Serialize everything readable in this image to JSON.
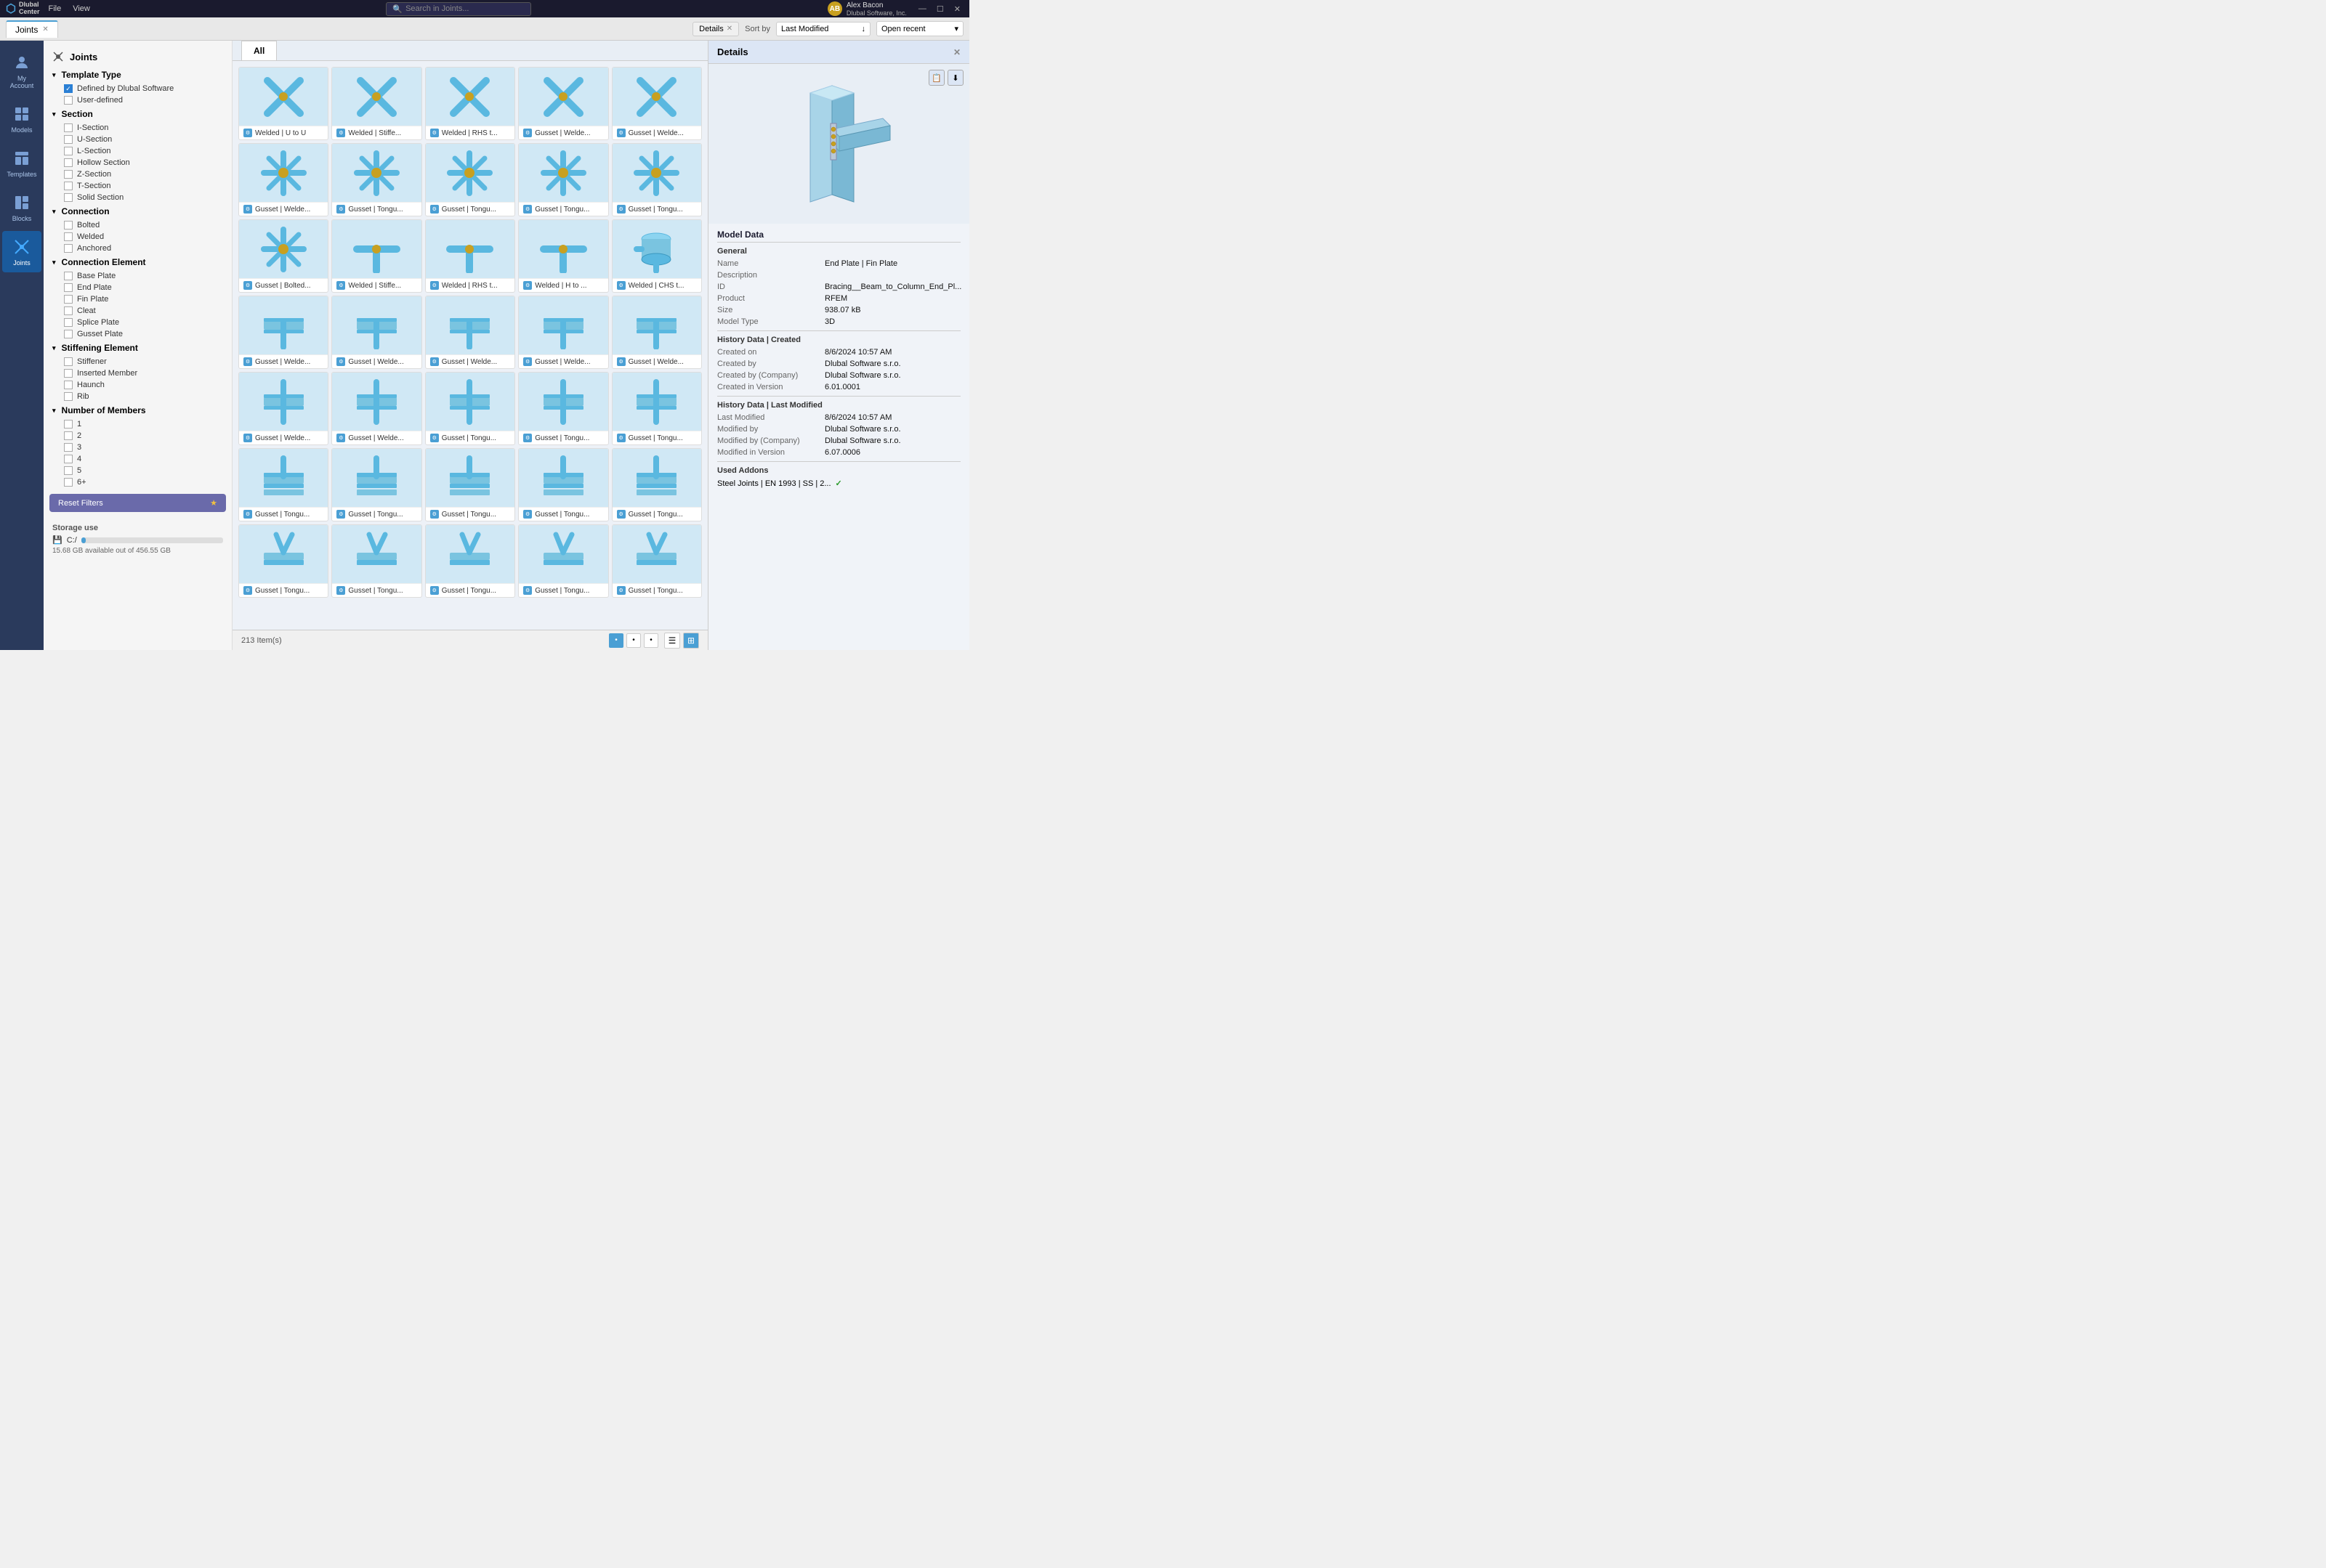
{
  "topbar": {
    "logo": "Dlubal Center",
    "menu": [
      "File",
      "View"
    ],
    "search_placeholder": "Search in Joints...",
    "user_name": "Alex Bacon",
    "user_company": "Dlubal Software, Inc.",
    "user_initials": "AB",
    "controls": [
      "—",
      "☐",
      "✕"
    ]
  },
  "tab": {
    "label": "Joints",
    "active": true
  },
  "toolbar": {
    "details_label": "Details",
    "sort_label": "Sort by",
    "sort_value": "Last Modified",
    "open_label": "Open recent",
    "sort_arrow": "↓"
  },
  "sidebar_icons": [
    {
      "id": "my-account",
      "label": "My Account",
      "icon": "person"
    },
    {
      "id": "models",
      "label": "Models",
      "icon": "cube"
    },
    {
      "id": "templates",
      "label": "Templates",
      "icon": "template"
    },
    {
      "id": "blocks",
      "label": "Blocks",
      "icon": "blocks"
    },
    {
      "id": "joints",
      "label": "Joints",
      "icon": "joints",
      "active": true
    }
  ],
  "filter_panel": {
    "title": "Joints",
    "sections": [
      {
        "id": "template-type",
        "label": "Template Type",
        "expanded": true,
        "items": [
          {
            "label": "Defined by Dlubal Software",
            "checked": true
          },
          {
            "label": "User-defined",
            "checked": false
          }
        ]
      },
      {
        "id": "section",
        "label": "Section",
        "expanded": true,
        "items": [
          {
            "label": "I-Section",
            "checked": false
          },
          {
            "label": "U-Section",
            "checked": false
          },
          {
            "label": "L-Section",
            "checked": false
          },
          {
            "label": "Hollow Section",
            "checked": false
          },
          {
            "label": "Z-Section",
            "checked": false
          },
          {
            "label": "T-Section",
            "checked": false
          },
          {
            "label": "Solid Section",
            "checked": false
          }
        ]
      },
      {
        "id": "connection",
        "label": "Connection",
        "expanded": true,
        "items": [
          {
            "label": "Bolted",
            "checked": false
          },
          {
            "label": "Welded",
            "checked": false
          },
          {
            "label": "Anchored",
            "checked": false
          }
        ]
      },
      {
        "id": "connection-element",
        "label": "Connection Element",
        "expanded": true,
        "items": [
          {
            "label": "Base Plate",
            "checked": false
          },
          {
            "label": "End Plate",
            "checked": false
          },
          {
            "label": "Fin Plate",
            "checked": false
          },
          {
            "label": "Cleat",
            "checked": false
          },
          {
            "label": "Splice Plate",
            "checked": false
          },
          {
            "label": "Gusset Plate",
            "checked": false
          }
        ]
      },
      {
        "id": "stiffening-element",
        "label": "Stiffening Element",
        "expanded": true,
        "items": [
          {
            "label": "Stiffener",
            "checked": false
          },
          {
            "label": "Inserted Member",
            "checked": false
          },
          {
            "label": "Haunch",
            "checked": false
          },
          {
            "label": "Rib",
            "checked": false
          }
        ]
      },
      {
        "id": "number-of-members",
        "label": "Number of Members",
        "expanded": true,
        "items": [
          {
            "label": "1",
            "checked": false
          },
          {
            "label": "2",
            "checked": false
          },
          {
            "label": "3",
            "checked": false
          },
          {
            "label": "4",
            "checked": false
          },
          {
            "label": "5",
            "checked": false
          },
          {
            "label": "6+",
            "checked": false
          }
        ]
      }
    ],
    "reset_label": "Reset Filters",
    "star_icon": "★",
    "storage_label": "Storage use",
    "storage_drive": "C:/",
    "storage_used_gb": "15.68",
    "storage_total_gb": "456.55",
    "storage_text": "15.68 GB available out of 456.55 GB",
    "storage_percent": 3
  },
  "content": {
    "tabs": [
      {
        "label": "All",
        "active": true
      }
    ],
    "items": [
      {
        "label": "Welded | U to U",
        "type": "x"
      },
      {
        "label": "Welded | Stiffe...",
        "type": "x"
      },
      {
        "label": "Welded | RHS t...",
        "type": "x"
      },
      {
        "label": "Gusset | Welde...",
        "type": "x"
      },
      {
        "label": "Gusset | Welde...",
        "type": "x"
      },
      {
        "label": "Gusset | Welde...",
        "type": "x4"
      },
      {
        "label": "Gusset | Tongu...",
        "type": "x4"
      },
      {
        "label": "Gusset | Tongu...",
        "type": "x4"
      },
      {
        "label": "Gusset | Tongu...",
        "type": "x4"
      },
      {
        "label": "Gusset | Tongu...",
        "type": "x4"
      },
      {
        "label": "Gusset | Bolted...",
        "type": "x4"
      },
      {
        "label": "Welded | Stiffe...",
        "type": "t"
      },
      {
        "label": "Welded | RHS t...",
        "type": "t"
      },
      {
        "label": "Welded | H to ...",
        "type": "t"
      },
      {
        "label": "Welded | CHS t...",
        "type": "cylinder"
      },
      {
        "label": "Gusset | Welde...",
        "type": "beam"
      },
      {
        "label": "Gusset | Welde...",
        "type": "beam"
      },
      {
        "label": "Gusset | Welde...",
        "type": "beam"
      },
      {
        "label": "Gusset | Welde...",
        "type": "beam"
      },
      {
        "label": "Gusset | Welde...",
        "type": "beam"
      },
      {
        "label": "Gusset | Welde...",
        "type": "tcross"
      },
      {
        "label": "Gusset | Welde...",
        "type": "tcross"
      },
      {
        "label": "Gusset | Tongu...",
        "type": "tcross"
      },
      {
        "label": "Gusset | Tongu...",
        "type": "tcross"
      },
      {
        "label": "Gusset | Tongu...",
        "type": "tcross"
      },
      {
        "label": "Gusset | Tongu...",
        "type": "tbeam"
      },
      {
        "label": "Gusset | Tongu...",
        "type": "tbeam"
      },
      {
        "label": "Gusset | Tongu...",
        "type": "tbeam"
      },
      {
        "label": "Gusset | Tongu...",
        "type": "tbeam"
      },
      {
        "label": "Gusset | Tongu...",
        "type": "tbeam"
      },
      {
        "label": "Gusset | Tongu...",
        "type": "ybeam"
      },
      {
        "label": "Gusset | Tongu...",
        "type": "ybeam"
      },
      {
        "label": "Gusset | Tongu...",
        "type": "ybeam"
      },
      {
        "label": "Gusset | Tongu...",
        "type": "ybeam"
      },
      {
        "label": "Gusset | Tongu...",
        "type": "ybeam"
      }
    ],
    "footer": {
      "count_label": "213 Item(s)",
      "page_dots": [
        "•",
        "•",
        "•"
      ],
      "page_active": 0
    }
  },
  "details": {
    "header": "Details",
    "close_icon": "✕",
    "model_data_label": "Model Data",
    "general_label": "General",
    "name_key": "Name",
    "name_val": "End Plate | Fin Plate",
    "desc_key": "Description",
    "desc_val": "",
    "id_key": "ID",
    "id_val": "Bracing__Beam_to_Column_End_Pl...",
    "product_key": "Product",
    "product_val": "RFEM",
    "size_key": "Size",
    "size_val": "938.07 kB",
    "model_type_key": "Model Type",
    "model_type_val": "3D",
    "history_created_label": "History Data | Created",
    "created_on_key": "Created on",
    "created_on_val": "8/6/2024 10:57 AM",
    "created_by_key": "Created by",
    "created_by_val": "Dlubal Software s.r.o.",
    "created_company_key": "Created by (Company)",
    "created_company_val": "Dlubal Software s.r.o.",
    "created_version_key": "Created in Version",
    "created_version_val": "6.01.0001",
    "history_modified_label": "History Data | Last Modified",
    "modified_key": "Last Modified",
    "modified_val": "8/6/2024 10:57 AM",
    "modified_by_key": "Modified by",
    "modified_by_val": "Dlubal Software s.r.o.",
    "modified_company_key": "Modified by (Company)",
    "modified_company_val": "Dlubal Software s.r.o.",
    "modified_version_key": "Modified in Version",
    "modified_version_val": "6.07.0006",
    "addons_label": "Used Addons",
    "addon_val": "Steel Joints | EN 1993 | SS | 2...",
    "addon_check": "✓"
  }
}
